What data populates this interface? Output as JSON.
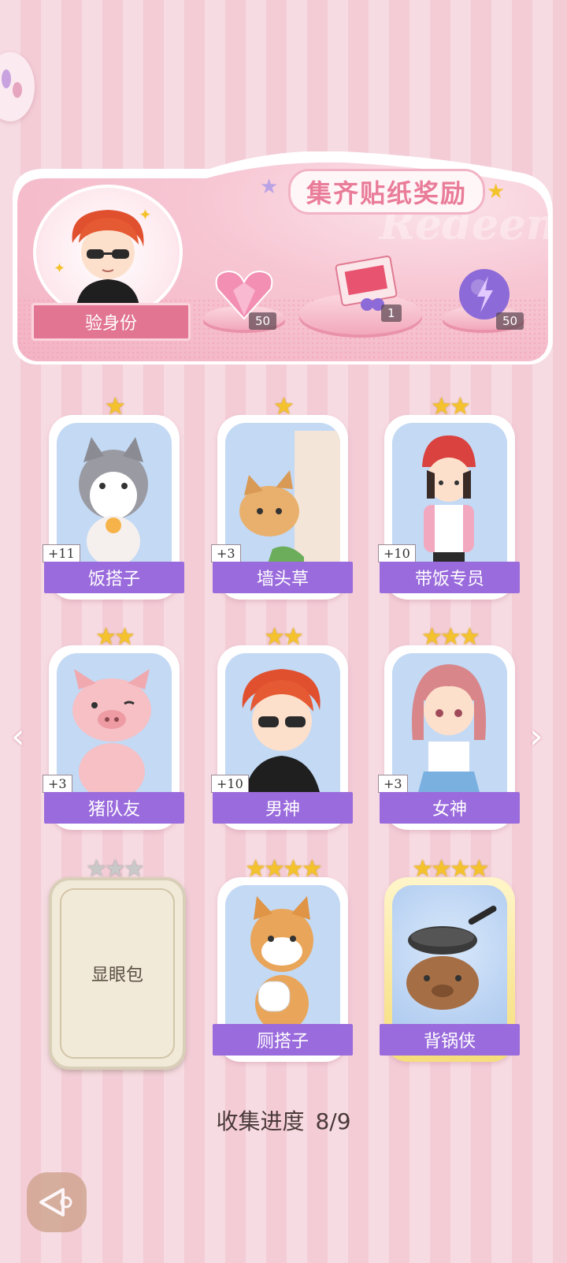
{
  "banner": {
    "title": "集齐贴纸奖励",
    "watermark": "Redeem",
    "verify_label": "验身份",
    "rewards": [
      {
        "icon": "pink-heart-gem-icon",
        "count": "50"
      },
      {
        "icon": "gift-box-icon",
        "count": "1"
      },
      {
        "icon": "purple-lightning-orb-icon",
        "count": "50"
      }
    ]
  },
  "cards": [
    {
      "label": "饭搭子",
      "plus": "+11",
      "stars": 1,
      "art": "cat-with-spoon-fork"
    },
    {
      "label": "墙头草",
      "plus": "+3",
      "stars": 1,
      "art": "squirrel-behind-wall"
    },
    {
      "label": "带饭专员",
      "plus": "+10",
      "stars": 2,
      "art": "girl-with-red-beanie"
    },
    {
      "label": "猪队友",
      "plus": "+3",
      "stars": 2,
      "art": "pig-waving"
    },
    {
      "label": "男神",
      "plus": "+10",
      "stars": 2,
      "art": "boy-with-sunglasses"
    },
    {
      "label": "女神",
      "plus": "+3",
      "stars": 3,
      "art": "girl-in-sailor-uniform"
    },
    {
      "label": "显眼包",
      "plus": "",
      "stars": 3,
      "locked": true
    },
    {
      "label": "厕搭子",
      "plus": "",
      "stars": 4,
      "art": "shiba-with-toilet-paper"
    },
    {
      "label": "背锅侠",
      "plus": "",
      "stars": 4,
      "art": "capybara-with-wok",
      "golden": true
    }
  ],
  "progress": {
    "label": "收集进度",
    "value": "8/9"
  },
  "colors": {
    "label_purple": "#9a6bdc",
    "banner_pink": "#f3b3c4",
    "title_pink": "#e97c98"
  }
}
